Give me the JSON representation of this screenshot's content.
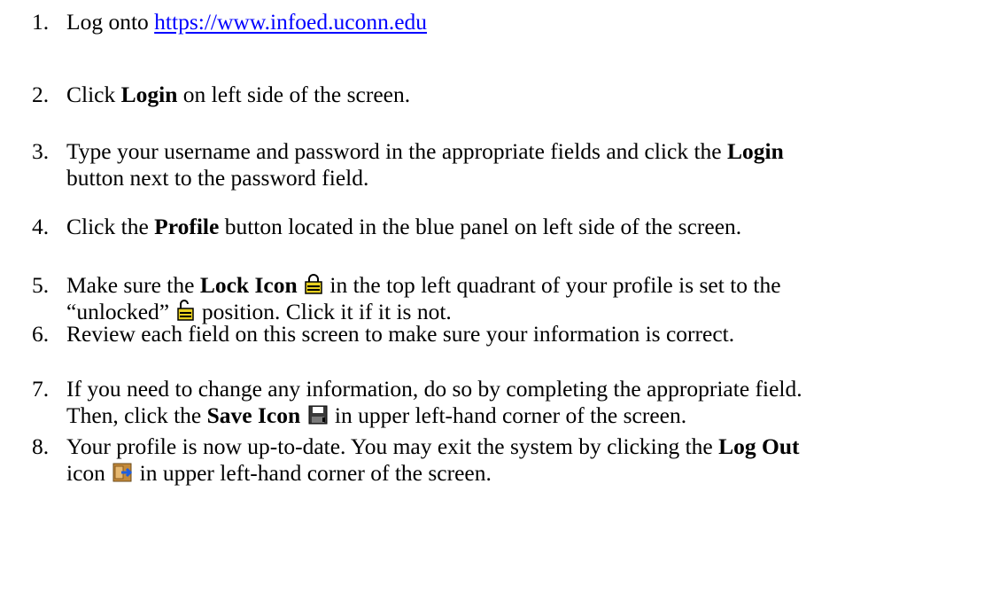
{
  "steps": [
    {
      "num": "1.",
      "lines": [
        [
          "Log onto ",
          {
            "link": "https://www.infoed.uconn.edu"
          }
        ]
      ]
    },
    {
      "num": "2.",
      "lines": [
        [
          "Click ",
          {
            "b": "Login"
          },
          " on left side of the screen."
        ]
      ]
    },
    {
      "num": "3.",
      "lines": [
        [
          "Type your username and password in the appropriate fields and click the ",
          {
            "b": "Login"
          }
        ],
        [
          "button next to the password field."
        ]
      ]
    },
    {
      "num": "4.",
      "lines": [
        [
          "Click the ",
          {
            "b": "Profile"
          },
          " button located in the blue panel on left side of the screen."
        ]
      ]
    },
    {
      "num": "5.",
      "lines": [
        [
          "Make sure the ",
          {
            "b": "Lock Icon"
          },
          " ",
          {
            "icon": "lock-icon"
          },
          " in the top left quadrant of your profile is set to the"
        ],
        [
          "“unlocked” ",
          {
            "icon": "unlocked-icon"
          },
          " position.  Click it if it is not."
        ]
      ]
    },
    {
      "num": "6.",
      "lines": [
        [
          "Review each field on this screen to make sure your information is correct."
        ]
      ]
    },
    {
      "num": "7.",
      "lines": [
        [
          "If you need to change any information, do so by completing the appropriate field."
        ],
        [
          "Then, click the ",
          {
            "b": "Save Icon"
          },
          " ",
          {
            "icon": "save-icon"
          },
          "  in upper left-hand corner of the screen."
        ]
      ]
    },
    {
      "num": "8.",
      "lines": [
        [
          "Your profile is now up-to-date.  You may exit the system by clicking the ",
          {
            "b": "Log Out"
          }
        ],
        [
          "icon ",
          {
            "icon": "logout-icon"
          },
          " in upper left-hand corner of the screen."
        ]
      ]
    }
  ]
}
